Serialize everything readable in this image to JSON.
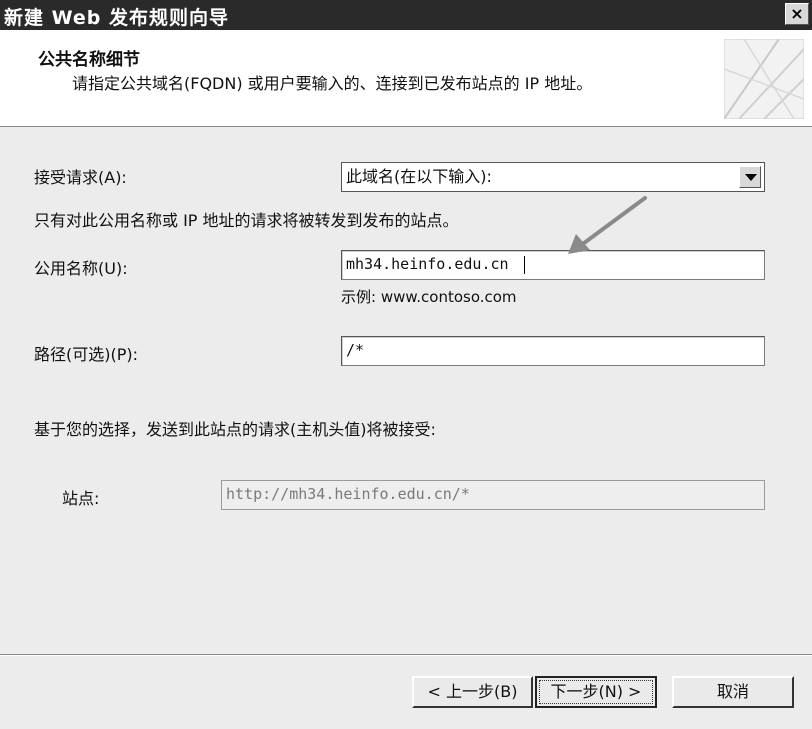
{
  "window": {
    "title": "新建 Web 发布规则向导",
    "close_label": "×"
  },
  "header": {
    "title": "公共名称细节",
    "description": "请指定公共域名(FQDN) 或用户要输入的、连接到已发布站点的 IP 地址。"
  },
  "form": {
    "accept_label": "接受请求(A):",
    "accept_value": "此域名(在以下输入):",
    "info_text": "只有对此公用名称或 IP 地址的请求将被转发到发布的站点。",
    "public_name_label": "公用名称(U):",
    "public_name_value": "mh34.heinfo.edu.cn",
    "example_text": "示例: www.contoso.com",
    "path_label": "路径(可选)(P):",
    "path_value": "/*",
    "summary_text": "基于您的选择，发送到此站点的请求(主机头值)将被接受:",
    "site_label": "站点:",
    "site_value": "http://mh34.heinfo.edu.cn/*"
  },
  "buttons": {
    "back": "< 上一步(B)",
    "next": "下一步(N) >",
    "cancel": "取消"
  }
}
